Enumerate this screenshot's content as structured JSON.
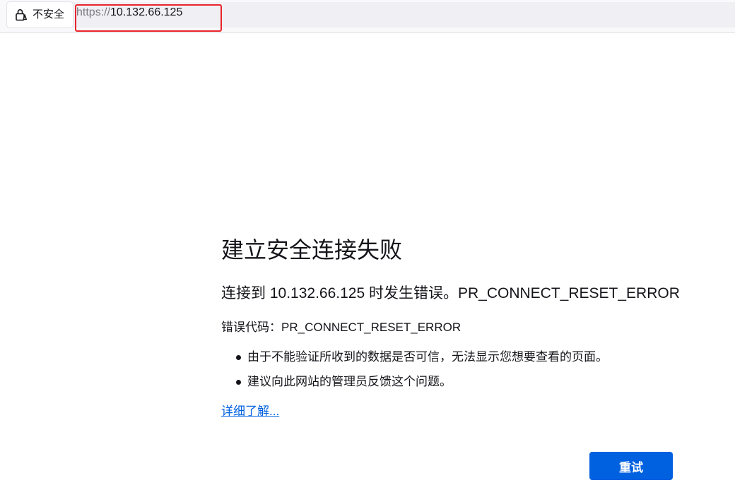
{
  "address_bar": {
    "identity_label": "不安全",
    "lock_icon": "insecure-lock-icon",
    "url_scheme": "https://",
    "url_host": "10.132.66.125"
  },
  "annotation": {
    "color": "#e8242a"
  },
  "error_page": {
    "title": "建立安全连接失败",
    "description": "连接到 10.132.66.125 时发生错误。PR_CONNECT_RESET_ERROR",
    "error_code_label": "错误代码：",
    "error_code": "PR_CONNECT_RESET_ERROR",
    "bullets": [
      "由于不能验证所收到的数据是否可信，无法显示您想要查看的页面。",
      "建议向此网站的管理员反馈这个问题。"
    ],
    "learn_more": "详细了解...",
    "retry_label": "重试"
  },
  "colors": {
    "accent": "#0061e0",
    "text": "#15141a",
    "url_scheme": "#7a7a80"
  }
}
